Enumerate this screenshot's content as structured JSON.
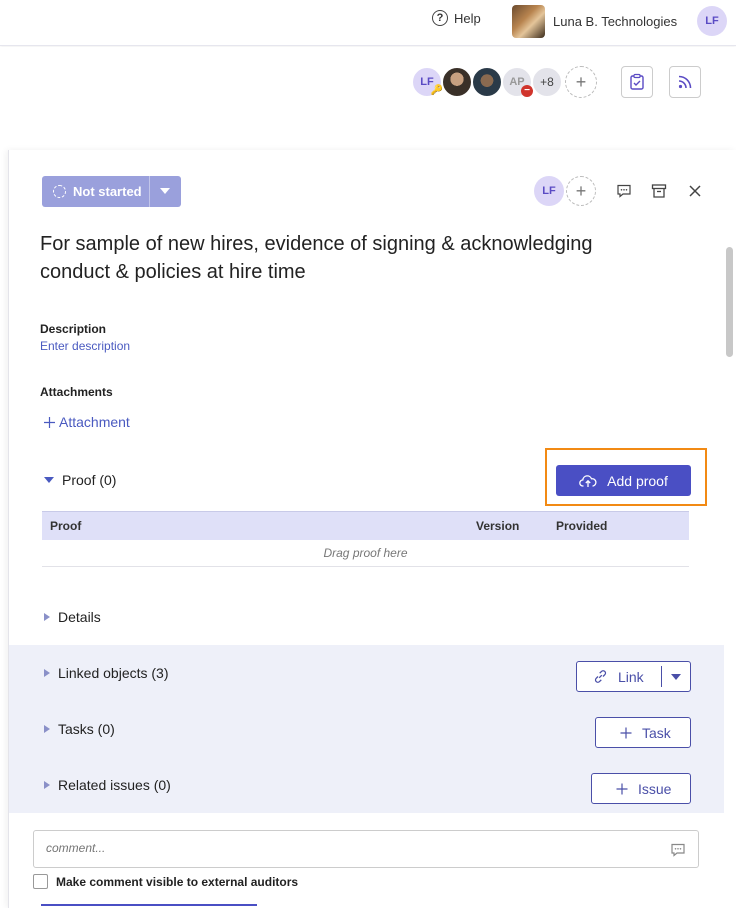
{
  "topbar": {
    "help_label": "Help",
    "org_name": "Luna B. Technologies",
    "user_initials": "LF"
  },
  "header": {
    "collaborators": [
      {
        "initials": "LF",
        "badge": "key-icon"
      },
      {
        "initials": "",
        "type": "photo"
      },
      {
        "initials": "",
        "type": "photo"
      },
      {
        "initials": "AP",
        "badge": "removed-icon"
      }
    ],
    "more_count": "+8",
    "add_label": "+"
  },
  "panel": {
    "status_label": "Not started",
    "assignee_initials": "LF",
    "title": "For sample of new hires, evidence of signing & acknowledging conduct & policies at hire time",
    "description_label": "Description",
    "description_placeholder": "Enter description",
    "attachments_label": "Attachments",
    "attachment_link": "Attachment",
    "proof_section": "Proof (0)",
    "add_proof_label": "Add proof",
    "proof_columns": [
      "Proof",
      "Version",
      "Provided"
    ],
    "drag_text": "Drag proof here",
    "details_section": "Details",
    "linked_section": "Linked objects (3)",
    "link_label": "Link",
    "tasks_section": "Tasks (0)",
    "task_label": "Task",
    "issues_section": "Related issues (0)",
    "issue_label": "Issue",
    "comment_placeholder": "comment...",
    "auditor_checkbox_label": "Make comment visible to external auditors"
  },
  "colors": {
    "accent": "#4a4fc4",
    "status": "#9aa0dc",
    "highlight": "#f28a14",
    "band": "#eef0f9"
  }
}
